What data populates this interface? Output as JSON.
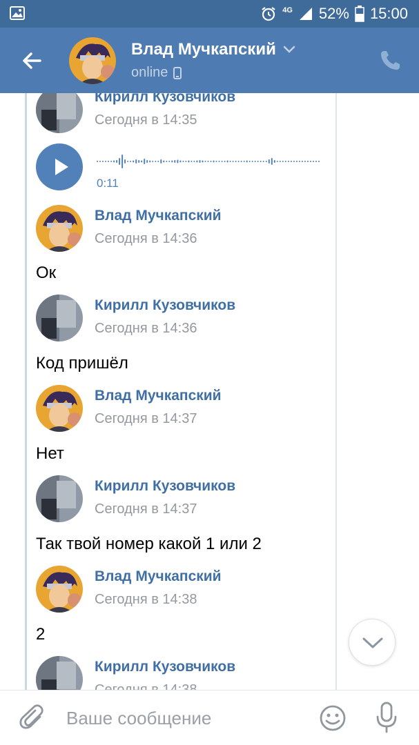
{
  "status_bar": {
    "battery": "52%",
    "time": "15:00",
    "network": "4G",
    "icons": [
      "image-icon",
      "alarm-icon",
      "signal-icon",
      "battery-icon"
    ]
  },
  "header": {
    "title": "Влад Мучкапский",
    "subtitle": "online",
    "icons": [
      "back-arrow-icon",
      "chevron-down-icon",
      "mobile-icon",
      "phone-icon"
    ]
  },
  "messages": [
    {
      "author": "Кирилл Кузовчиков",
      "time": "Сегодня в 14:35",
      "avatar": "photo"
    },
    {
      "author": "Влад Мучкапский",
      "time": "Сегодня в 14:36",
      "text": "Ок",
      "avatar": "anime"
    },
    {
      "author": "Кирилл Кузовчиков",
      "time": "Сегодня в 14:36",
      "text": "Код пришёл",
      "avatar": "photo"
    },
    {
      "author": "Влад Мучкапский",
      "time": "Сегодня в 14:37",
      "text": "Нет",
      "avatar": "anime"
    },
    {
      "author": "Кирилл Кузовчиков",
      "time": "Сегодня в 14:37",
      "text": "Так твой номер какой 1 или 2",
      "avatar": "photo"
    },
    {
      "author": "Влад Мучкапский",
      "time": "Сегодня в 14:38",
      "text": "2",
      "avatar": "anime"
    },
    {
      "author": "Кирилл Кузовчиков",
      "time": "Сегодня в 14:38",
      "avatar": "photo"
    }
  ],
  "voice_message": {
    "duration": "0:11"
  },
  "composer": {
    "placeholder": "Ваше сообщение",
    "icons": [
      "paperclip-icon",
      "smile-icon",
      "microphone-icon"
    ]
  },
  "colors": {
    "status_bar": "#3e6b99",
    "header": "#4e7bb2",
    "accent": "#5181b8",
    "author_name": "#3f6fa4",
    "timestamp": "#93999f"
  }
}
